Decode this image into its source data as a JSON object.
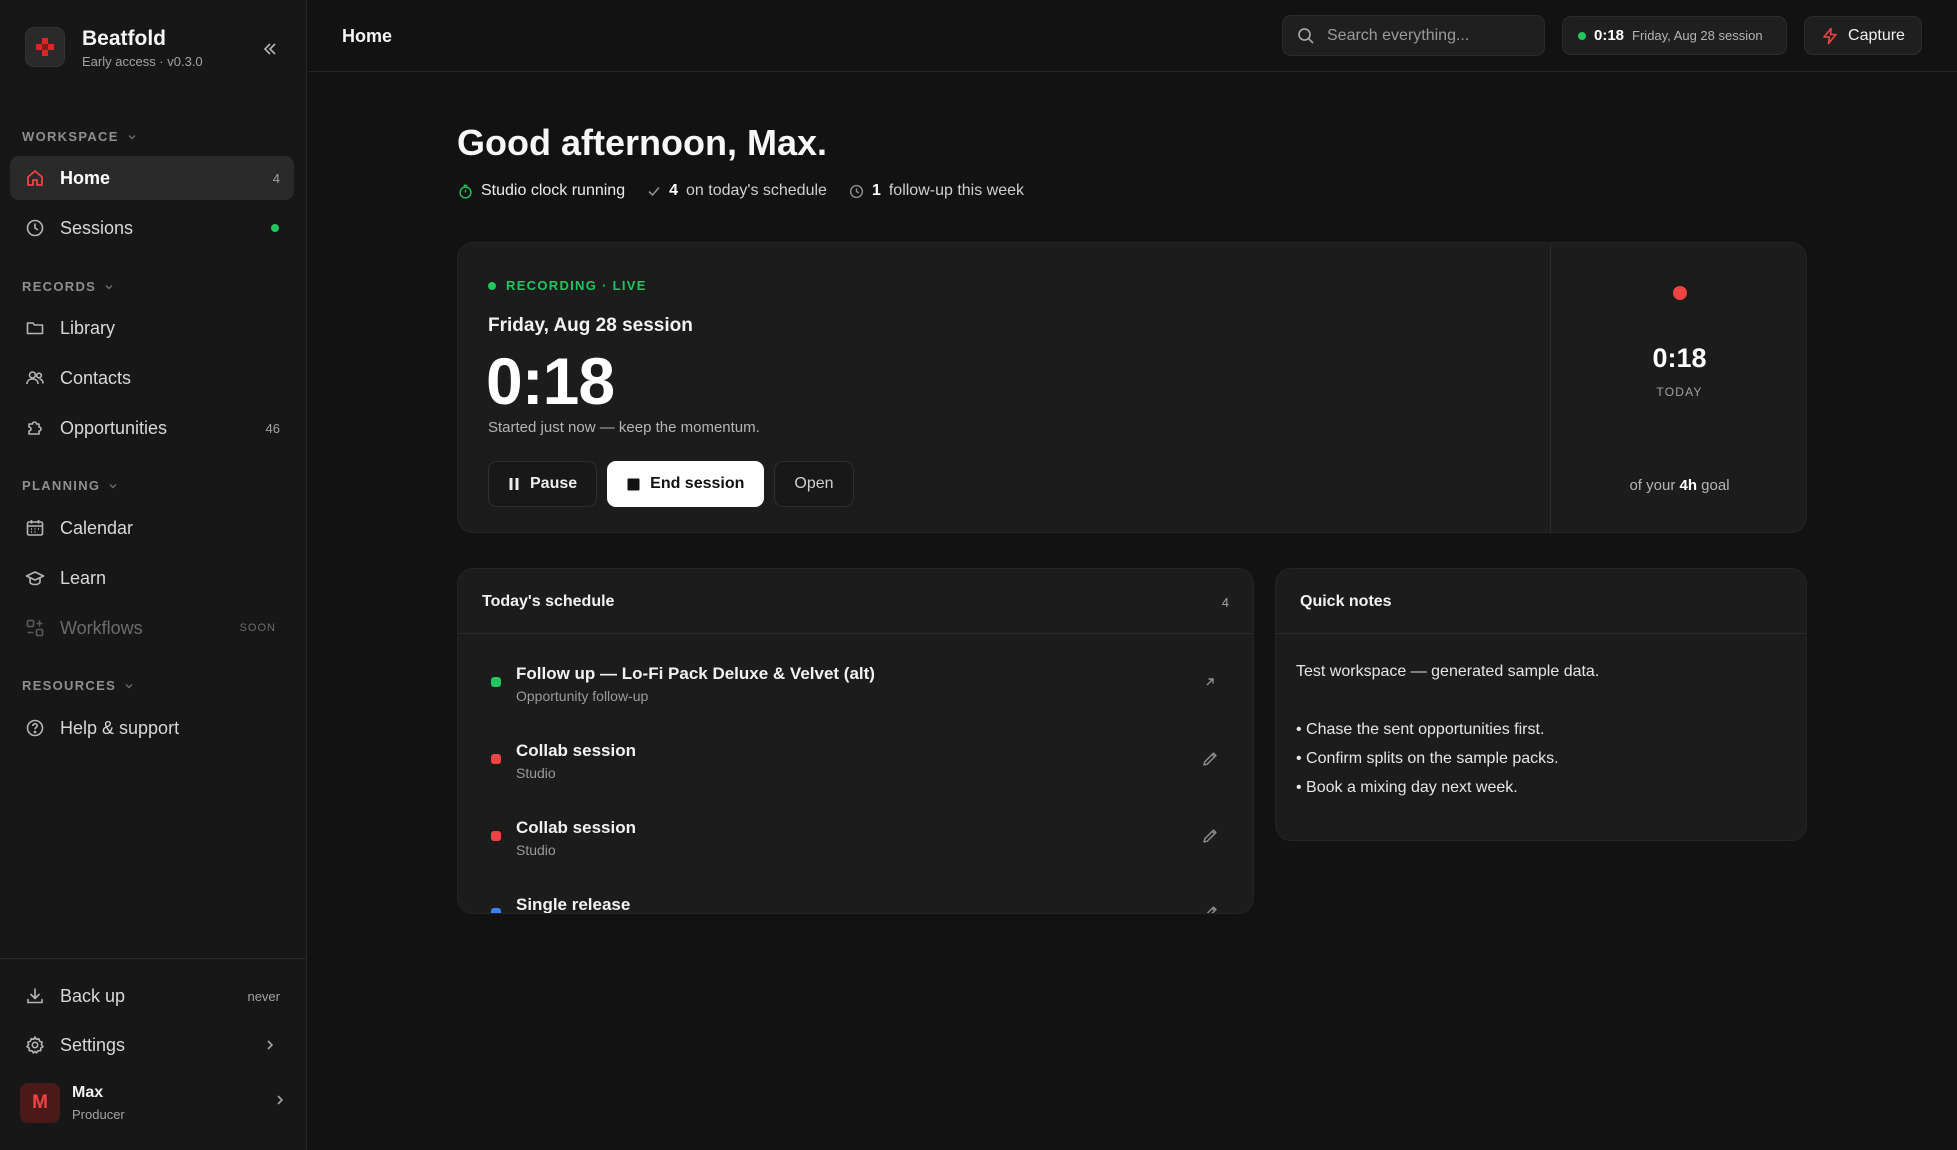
{
  "brand": {
    "name": "Beatfold",
    "subtitle": "Early access · v0.3.0"
  },
  "sidebar": {
    "sections": {
      "workspace": "WORKSPACE",
      "records": "RECORDS",
      "planning": "PLANNING",
      "resources": "RESOURCES"
    },
    "items": {
      "home": {
        "label": "Home",
        "count": "4",
        "icon": "home-icon"
      },
      "sessions": {
        "label": "Sessions",
        "icon": "clock-icon",
        "status": "live-dot"
      },
      "library": {
        "label": "Library",
        "icon": "folder-icon"
      },
      "contacts": {
        "label": "Contacts",
        "icon": "users-icon"
      },
      "opportunities": {
        "label": "Opportunities",
        "count": "46",
        "icon": "puzzle-icon"
      },
      "calendar": {
        "label": "Calendar",
        "icon": "calendar-icon"
      },
      "learn": {
        "label": "Learn",
        "icon": "graduation-cap-icon"
      },
      "workflows": {
        "label": "Workflows",
        "badge": "SOON",
        "icon": "workflow-icon"
      },
      "help": {
        "label": "Help & support",
        "icon": "help-circle-icon"
      }
    },
    "footer": {
      "backup": {
        "label": "Back up",
        "meta": "never",
        "icon": "download-icon"
      },
      "settings": {
        "label": "Settings",
        "icon": "gear-icon"
      }
    },
    "user": {
      "initial": "M",
      "name": "Max",
      "role": "Producer"
    }
  },
  "topbar": {
    "title": "Home",
    "search_placeholder": "Search everything...",
    "session_time": "0:18",
    "session_label": "Friday, Aug 28 session",
    "capture_label": "Capture"
  },
  "greeting": {
    "title": "Good afternoon, Max.",
    "clock_status": "Studio clock running",
    "schedule_count": "4",
    "schedule_text": "on today's schedule",
    "followup_count": "1",
    "followup_text": "follow-up this week"
  },
  "recording": {
    "status": "RECORDING · LIVE",
    "title": "Friday, Aug 28 session",
    "time": "0:18",
    "subtitle": "Started just now — keep the momentum.",
    "buttons": {
      "pause": "Pause",
      "end": "End session",
      "open": "Open"
    },
    "today_time": "0:18",
    "today_label": "TODAY",
    "goal_prefix": "of your",
    "goal_value": "4h",
    "goal_suffix": "goal"
  },
  "schedule": {
    "title": "Today's schedule",
    "count": "4",
    "items": [
      {
        "title": "Follow up — Lo-Fi Pack Deluxe & Velvet (alt)",
        "subtitle": "Opportunity follow-up",
        "color": "#22c55e",
        "action_icon": "arrow-up-right-icon"
      },
      {
        "title": "Collab session",
        "subtitle": "Studio",
        "color": "#ef4444",
        "action_icon": "pencil-icon"
      },
      {
        "title": "Collab session",
        "subtitle": "Studio",
        "color": "#ef4444",
        "action_icon": "pencil-icon"
      },
      {
        "title": "Single release",
        "subtitle": "",
        "color": "#3b82f6",
        "action_icon": "pencil-icon"
      }
    ]
  },
  "notes": {
    "title": "Quick notes",
    "intro": "Test workspace — generated sample data.",
    "bullets": [
      "• Chase the sent opportunities first.",
      "• Confirm splits on the sample packs.",
      "• Book a mixing day next week."
    ]
  },
  "colors": {
    "accent": "#ef4444",
    "live": "#22c55e",
    "background": "#121212",
    "card": "#1c1c1c"
  }
}
